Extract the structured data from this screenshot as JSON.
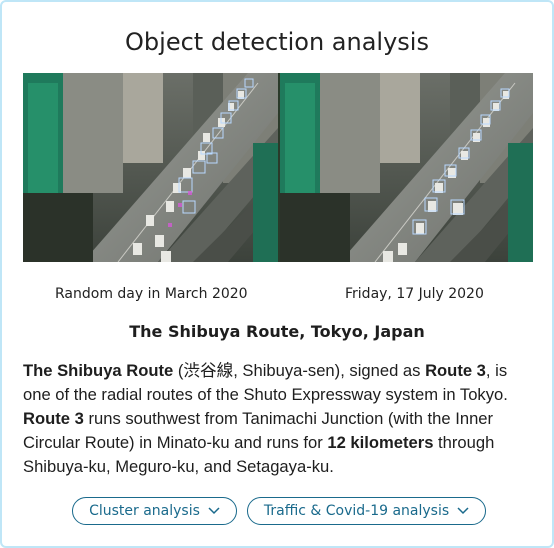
{
  "title": "Object detection analysis",
  "images": {
    "left_caption": "Random day in March 2020",
    "right_caption": "Friday, 17 July 2020"
  },
  "subtitle": "The Shibuya Route, Tokyo, Japan",
  "description": {
    "p1_bold": "The Shibuya Route",
    "p1_text": " (渋谷線, Shibuya-sen), signed as ",
    "p2_bold": "Route 3",
    "p2_text": ", is one of the radial routes of the Shuto Expressway system in Tokyo. ",
    "p3_bold": "Route 3",
    "p3_text": " runs southwest from Tanimachi Junction (with the Inner Circular Route) in Minato-ku and runs for ",
    "p4_bold": "12 kilometers",
    "p4_text": " through Shibuya-ku, Meguro-ku, and Setagaya-ku."
  },
  "buttons": {
    "cluster": "Cluster analysis",
    "traffic": "Traffic & Covid-19 analysis"
  },
  "colors": {
    "border": "#bfe6f7",
    "accent": "#1a6a8c",
    "detection_box": "#b8d8ff"
  }
}
